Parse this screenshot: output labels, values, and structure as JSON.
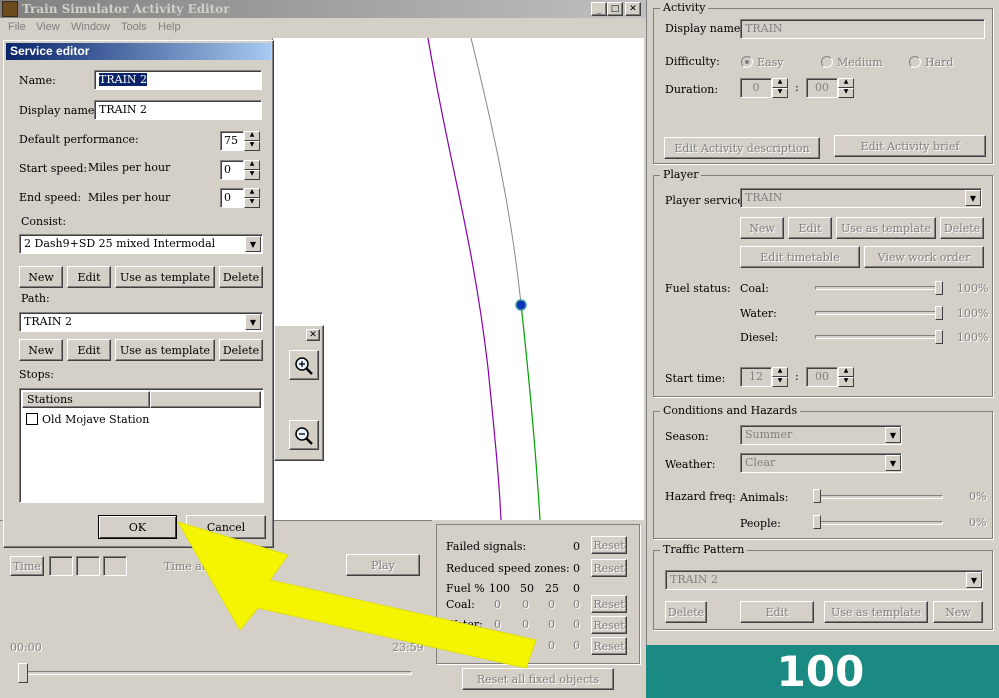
{
  "app": {
    "title": "Train Simulator Activity Editor",
    "menu": [
      "File",
      "View",
      "Window",
      "Tools",
      "Help"
    ]
  },
  "service_editor": {
    "title": "Service editor",
    "name_label": "Name:",
    "name_value": "TRAIN 2",
    "display_name_label": "Display name:",
    "display_name_value": "TRAIN 2",
    "default_perf_label": "Default performance:",
    "default_perf_value": "75",
    "start_speed_label": "Start speed:",
    "start_speed_unit": "Miles per hour",
    "start_speed_value": "0",
    "end_speed_label": "End speed:",
    "end_speed_unit": "Miles per hour",
    "end_speed_value": "0",
    "consist_label": "Consist:",
    "consist_value": "2 Dash9+SD 25 mixed Intermodal",
    "path_label": "Path:",
    "path_value": "TRAIN 2",
    "buttons": {
      "new": "New",
      "edit": "Edit",
      "template": "Use as template",
      "delete": "Delete"
    },
    "stops_label": "Stops:",
    "stations_col": "Stations",
    "stations": [
      "Old Mojave Station"
    ],
    "ok": "OK",
    "cancel": "Cancel"
  },
  "map": {
    "zoom_in": "zoom-in",
    "zoom_out": "zoom-out"
  },
  "timebar": {
    "time_btn": "Time",
    "accel_label": "Time accelera",
    "play": "Play",
    "start_time": "00:00",
    "end_time": "23:59"
  },
  "stats": {
    "failed_signals_label": "Failed signals:",
    "failed_signals_value": "0",
    "reduced_zones_label": "Reduced speed zones:",
    "reduced_zones_value": "0",
    "fuel_label": "Fuel %",
    "fuel_cols": [
      "100",
      "50",
      "25",
      "0"
    ],
    "coal_label": "Coal:",
    "coal_vals": [
      "0",
      "0",
      "0",
      "0"
    ],
    "water_label": "Water:",
    "water_vals": [
      "0",
      "0",
      "0",
      "0"
    ],
    "diesel_vals": [
      "0",
      "0",
      "0",
      "0"
    ],
    "reset": "Reset",
    "reset_all": "Reset all fixed objects"
  },
  "activity": {
    "title": "Activity",
    "display_name_label": "Display name:",
    "display_name_value": "TRAIN",
    "difficulty_label": "Difficulty:",
    "difficulty": [
      "Easy",
      "Medium",
      "Hard"
    ],
    "duration_label": "Duration:",
    "duration_h": "0",
    "duration_m": "00",
    "edit_desc": "Edit Activity description",
    "edit_brief": "Edit Activity brief"
  },
  "player": {
    "title": "Player",
    "service_label": "Player service:",
    "service_value": "TRAIN",
    "new": "New",
    "edit": "Edit",
    "template": "Use as template",
    "delete": "Delete",
    "edit_timetable": "Edit timetable",
    "view_work_order": "View work order",
    "fuel_status_label": "Fuel status:",
    "coal_label": "Coal:",
    "coal_pct": "100%",
    "water_label": "Water:",
    "water_pct": "100%",
    "diesel_label": "Diesel:",
    "diesel_pct": "100%",
    "start_time_label": "Start time:",
    "start_h": "12",
    "start_m": "00"
  },
  "conditions": {
    "title": "Conditions and Hazards",
    "season_label": "Season:",
    "season_value": "Summer",
    "weather_label": "Weather:",
    "weather_value": "Clear",
    "hazard_label": "Hazard freq:",
    "animals_label": "Animals:",
    "animals_pct": "0%",
    "people_label": "People:",
    "people_pct": "0%"
  },
  "traffic": {
    "title": "Traffic Pattern",
    "value": "TRAIN 2",
    "delete": "Delete",
    "edit": "Edit",
    "template": "Use as template",
    "new": "New"
  },
  "overlay": {
    "score": "100",
    "score_bg": "#1a8a82",
    "arrow_color": "#f5f500"
  }
}
